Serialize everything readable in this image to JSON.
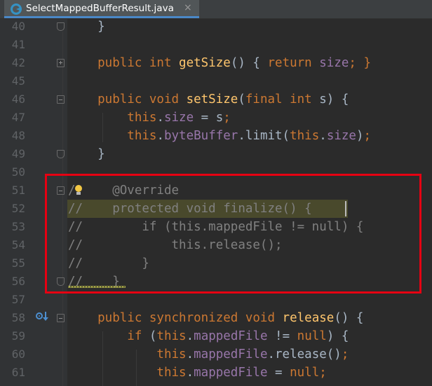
{
  "tab": {
    "title": "SelectMappedBufferResult.java",
    "close": "×"
  },
  "colors": {
    "keyword": "#cc7832",
    "method": "#ffc66d",
    "field": "#9876aa",
    "comment": "#808080",
    "annotation": "#bbb529",
    "plain": "#a9b7c6",
    "line_number": "#606366",
    "highlight_border": "#e60012",
    "tab_underline": "#4a88c7"
  },
  "lines": [
    {
      "num": "40",
      "fold": "end",
      "tokens": [
        {
          "t": "    }",
          "c": "plain"
        }
      ]
    },
    {
      "num": "41",
      "fold": "",
      "tokens": []
    },
    {
      "num": "42",
      "fold": "plus",
      "tokens": [
        {
          "t": "    public int ",
          "c": "keyword"
        },
        {
          "t": "getSize",
          "c": "method"
        },
        {
          "t": "() { ",
          "c": "plain"
        },
        {
          "t": "return ",
          "c": "keyword"
        },
        {
          "t": "size",
          "c": "field"
        },
        {
          "t": "; }",
          "c": "keyword"
        }
      ]
    },
    {
      "num": "45",
      "fold": "",
      "tokens": []
    },
    {
      "num": "46",
      "fold": "start",
      "tokens": [
        {
          "t": "    public void ",
          "c": "keyword"
        },
        {
          "t": "setSize",
          "c": "method"
        },
        {
          "t": "(",
          "c": "plain"
        },
        {
          "t": "final int ",
          "c": "keyword"
        },
        {
          "t": "s) {",
          "c": "plain"
        }
      ]
    },
    {
      "num": "47",
      "fold": "",
      "tokens": [
        {
          "t": "        this",
          "c": "keyword"
        },
        {
          "t": ".",
          "c": "plain"
        },
        {
          "t": "size",
          "c": "field"
        },
        {
          "t": " = s",
          "c": "plain"
        },
        {
          "t": ";",
          "c": "keyword"
        }
      ]
    },
    {
      "num": "48",
      "fold": "",
      "tokens": [
        {
          "t": "        this",
          "c": "keyword"
        },
        {
          "t": ".",
          "c": "plain"
        },
        {
          "t": "byteBuffer",
          "c": "field"
        },
        {
          "t": ".limit(",
          "c": "plain"
        },
        {
          "t": "this",
          "c": "keyword"
        },
        {
          "t": ".",
          "c": "plain"
        },
        {
          "t": "size",
          "c": "field"
        },
        {
          "t": ")",
          "c": "plain"
        },
        {
          "t": ";",
          "c": "keyword"
        }
      ]
    },
    {
      "num": "49",
      "fold": "end",
      "tokens": [
        {
          "t": "    }",
          "c": "plain"
        }
      ]
    },
    {
      "num": "50",
      "fold": "",
      "tokens": []
    },
    {
      "num": "51",
      "fold": "start",
      "tokens": [
        {
          "t": "/     @Override",
          "c": "comment"
        }
      ]
    },
    {
      "num": "52",
      "fold": "",
      "tokens": [
        {
          "t": "//    protected void finalize() {",
          "c": "comment"
        }
      ]
    },
    {
      "num": "53",
      "fold": "",
      "tokens": [
        {
          "t": "//        if (this.mappedFile != null) {",
          "c": "comment"
        }
      ]
    },
    {
      "num": "54",
      "fold": "",
      "tokens": [
        {
          "t": "//            this.release();",
          "c": "comment"
        }
      ]
    },
    {
      "num": "55",
      "fold": "",
      "tokens": [
        {
          "t": "//        }",
          "c": "comment"
        }
      ]
    },
    {
      "num": "56",
      "fold": "end",
      "tokens": [
        {
          "t": "//    }",
          "c": "comment"
        }
      ]
    },
    {
      "num": "57",
      "fold": "",
      "tokens": []
    },
    {
      "num": "58",
      "fold": "start",
      "tokens": [
        {
          "t": "    public synchronized void ",
          "c": "keyword"
        },
        {
          "t": "release",
          "c": "method"
        },
        {
          "t": "() {",
          "c": "plain"
        }
      ]
    },
    {
      "num": "59",
      "fold": "",
      "tokens": [
        {
          "t": "        if ",
          "c": "keyword"
        },
        {
          "t": "(",
          "c": "plain"
        },
        {
          "t": "this",
          "c": "keyword"
        },
        {
          "t": ".",
          "c": "plain"
        },
        {
          "t": "mappedFile",
          "c": "field"
        },
        {
          "t": " != ",
          "c": "plain"
        },
        {
          "t": "null",
          "c": "keyword"
        },
        {
          "t": ") {",
          "c": "plain"
        }
      ]
    },
    {
      "num": "60",
      "fold": "",
      "tokens": [
        {
          "t": "            this",
          "c": "keyword"
        },
        {
          "t": ".",
          "c": "plain"
        },
        {
          "t": "mappedFile",
          "c": "field"
        },
        {
          "t": ".release()",
          "c": "plain"
        },
        {
          "t": ";",
          "c": "keyword"
        }
      ]
    },
    {
      "num": "61",
      "fold": "",
      "tokens": [
        {
          "t": "            this",
          "c": "keyword"
        },
        {
          "t": ".",
          "c": "plain"
        },
        {
          "t": "mappedFile",
          "c": "field"
        },
        {
          "t": " = ",
          "c": "plain"
        },
        {
          "t": "null",
          "c": "keyword"
        },
        {
          "t": ";",
          "c": "keyword"
        }
      ]
    }
  ]
}
